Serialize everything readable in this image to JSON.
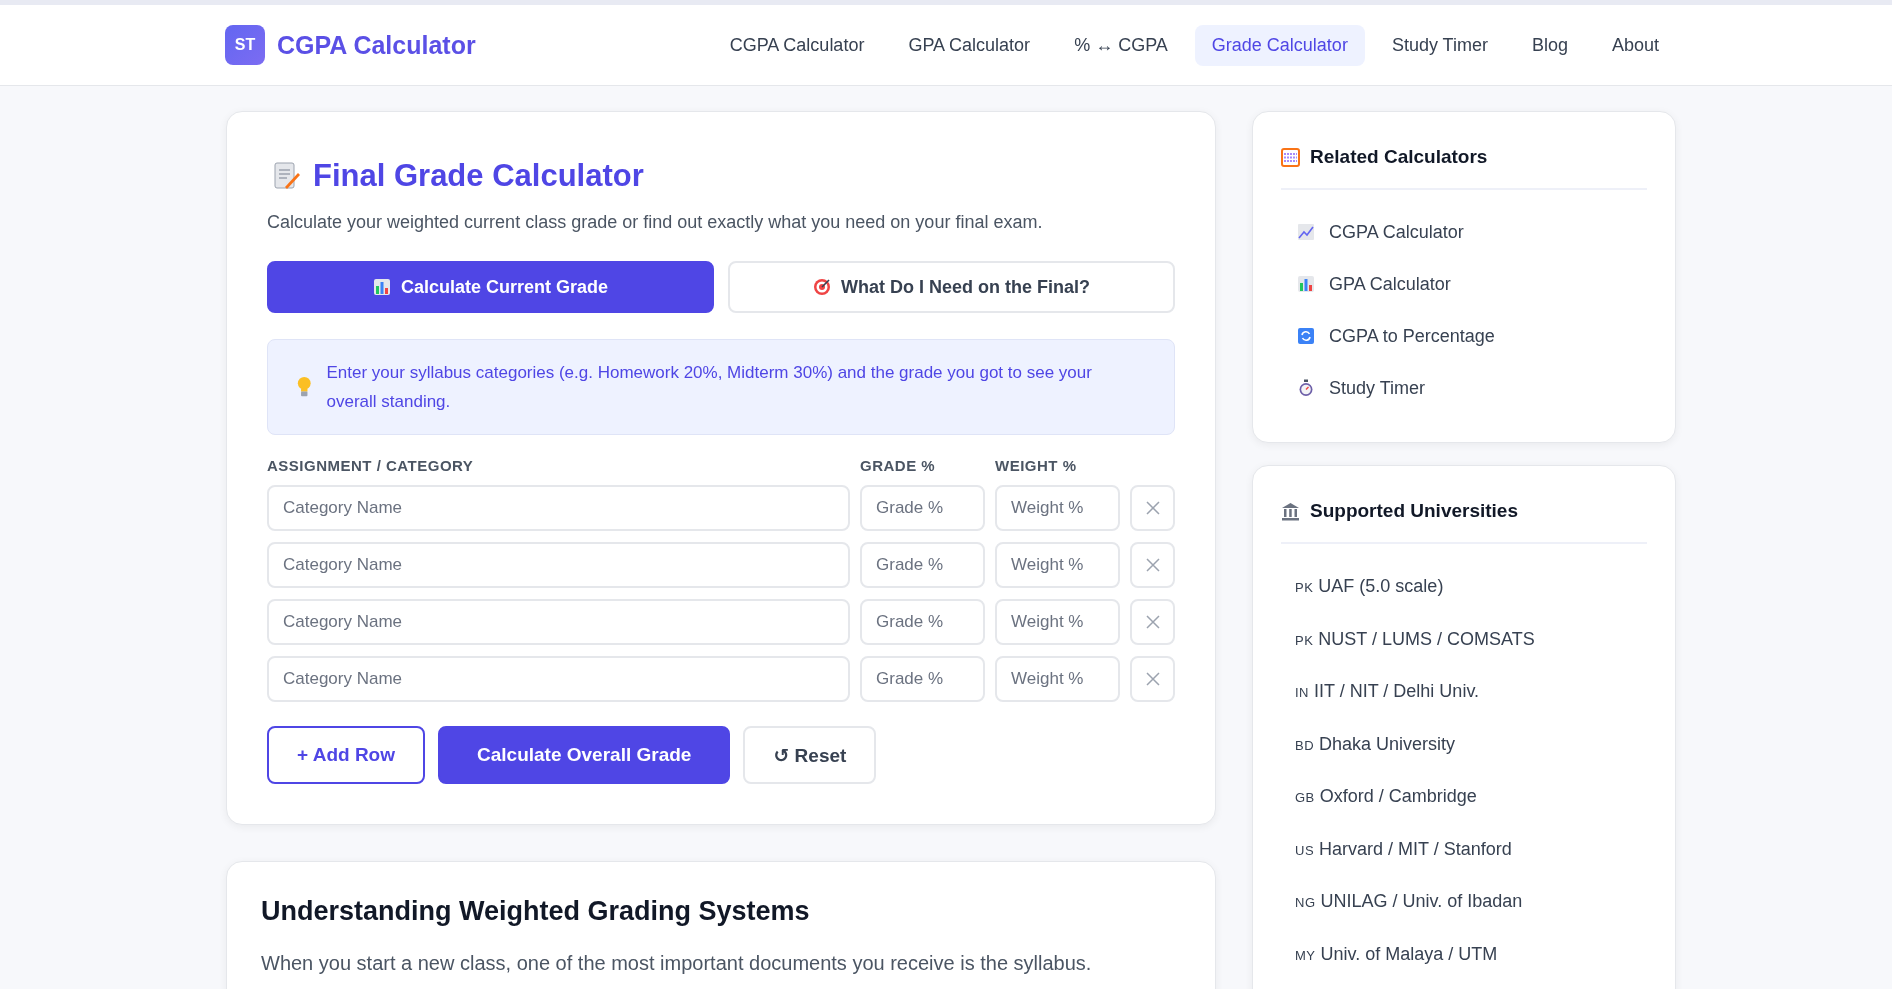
{
  "header": {
    "logo_badge": "ST",
    "brand": "CGPA Calculator",
    "nav": [
      {
        "label": "CGPA Calculator",
        "selected": false
      },
      {
        "label": "GPA Calculator",
        "selected": false
      },
      {
        "label": "% ↔ CGPA",
        "selected": false
      },
      {
        "label": "Grade Calculator",
        "selected": true
      },
      {
        "label": "Study Timer",
        "selected": false
      },
      {
        "label": "Blog",
        "selected": false
      },
      {
        "label": "About",
        "selected": false
      }
    ]
  },
  "calculator": {
    "title": "Final Grade Calculator",
    "subtitle": "Calculate your weighted current class grade or find out exactly what you need on your final exam.",
    "modes": [
      {
        "label": "Calculate Current Grade",
        "kind": "chart",
        "selected": true
      },
      {
        "label": "What Do I Need on the Final?",
        "kind": "target",
        "selected": false
      }
    ],
    "tip": "Enter your syllabus categories (e.g. Homework 20%, Midterm 30%) and the grade you got to see your overall standing.",
    "columns": [
      "ASSIGNMENT / CATEGORY",
      "GRADE %",
      "WEIGHT %"
    ],
    "rows": [
      {
        "category_placeholder": "Category Name",
        "grade_placeholder": "Grade %",
        "weight_placeholder": "Weight %"
      },
      {
        "category_placeholder": "Category Name",
        "grade_placeholder": "Grade %",
        "weight_placeholder": "Weight %"
      },
      {
        "category_placeholder": "Category Name",
        "grade_placeholder": "Grade %",
        "weight_placeholder": "Weight %"
      },
      {
        "category_placeholder": "Category Name",
        "grade_placeholder": "Grade %",
        "weight_placeholder": "Weight %"
      }
    ],
    "actions": [
      {
        "label": "+ Add Row",
        "kind": "outline"
      },
      {
        "label": "Calculate Overall Grade",
        "kind": "primary"
      },
      {
        "label": "↺ Reset",
        "kind": "plain"
      }
    ]
  },
  "article": {
    "heading": "Understanding Weighted Grading Systems",
    "paragraph": "When you start a new class, one of the most important documents you receive is the syllabus."
  },
  "related": {
    "title": "Related Calculators",
    "items": [
      {
        "label": "CGPA Calculator",
        "kind": "trend"
      },
      {
        "label": "GPA Calculator",
        "kind": "chart"
      },
      {
        "label": "CGPA to Percentage",
        "kind": "convert"
      },
      {
        "label": "Study Timer",
        "kind": "timer"
      }
    ]
  },
  "universities": {
    "title": "Supported Universities",
    "items": [
      {
        "code": "PK",
        "name": "UAF (5.0 scale)"
      },
      {
        "code": "PK",
        "name": "NUST / LUMS / COMSATS"
      },
      {
        "code": "IN",
        "name": "IIT / NIT / Delhi Univ."
      },
      {
        "code": "BD",
        "name": "Dhaka University"
      },
      {
        "code": "GB",
        "name": "Oxford / Cambridge"
      },
      {
        "code": "US",
        "name": "Harvard / MIT / Stanford"
      },
      {
        "code": "NG",
        "name": "UNILAG / Univ. of Ibadan"
      },
      {
        "code": "MY",
        "name": "Univ. of Malaya / UTM"
      }
    ]
  }
}
